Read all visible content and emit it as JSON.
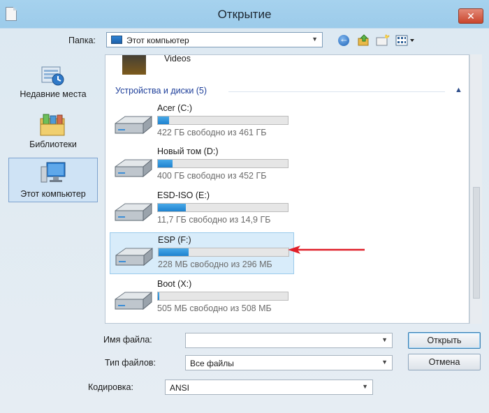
{
  "window": {
    "title": "Открытие",
    "close_glyph": "✕"
  },
  "toolbar": {
    "folder_label": "Папка:",
    "folder_value": "Этот компьютер",
    "icons": [
      "back-icon",
      "up-folder-icon",
      "new-folder-icon",
      "view-menu-icon"
    ]
  },
  "sidebar": {
    "items": [
      {
        "label": "Недавние места",
        "icon": "recent-places-icon"
      },
      {
        "label": "Библиотеки",
        "icon": "libraries-icon"
      },
      {
        "label": "Этот компьютер",
        "icon": "this-pc-icon",
        "selected": true
      }
    ]
  },
  "content": {
    "partial_item": {
      "label": "Videos"
    },
    "group_header": "Устройства и диски (5)",
    "drives": [
      {
        "name": "Acer (C:)",
        "free_text": "422 ГБ свободно из 461 ГБ",
        "used_fraction": 0.085
      },
      {
        "name": "Новый том (D:)",
        "free_text": "400 ГБ свободно из 452 ГБ",
        "used_fraction": 0.115
      },
      {
        "name": "ESD-ISO (E:)",
        "free_text": "11,7 ГБ свободно из 14,9 ГБ",
        "used_fraction": 0.215
      },
      {
        "name": "ESP (F:)",
        "free_text": "228 МБ свободно из 296 МБ",
        "used_fraction": 0.23,
        "selected": true
      },
      {
        "name": "Boot (X:)",
        "free_text": "505 МБ свободно из 508 МБ",
        "used_fraction": 0.006
      }
    ]
  },
  "footer": {
    "filename_label": "Имя файла:",
    "filename_value": "",
    "filetype_label": "Тип файлов:",
    "filetype_value": "Все файлы",
    "encoding_label": "Кодировка:",
    "encoding_value": "ANSI",
    "open_button": "Открыть",
    "cancel_button": "Отмена"
  },
  "colors": {
    "accent": "#1f82cf",
    "annotation_arrow": "#e0202a",
    "selection": "#d8ecfa"
  }
}
